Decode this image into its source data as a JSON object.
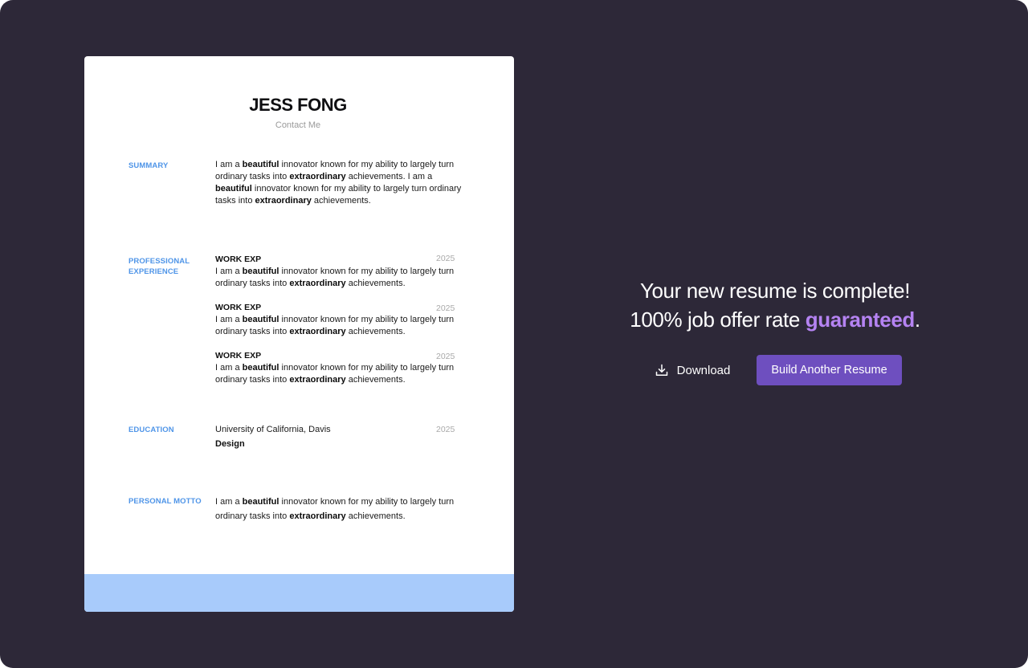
{
  "resume": {
    "name": "JESS FONG",
    "contact": "Contact Me",
    "summary": {
      "label": "SUMMARY",
      "parts": [
        "I am a ",
        "beautiful",
        " innovator known for my ability to largely turn ordinary tasks into ",
        "extraordinary",
        " achievements. I am a ",
        "beautiful",
        " innovator known for my ability to largely turn ordinary tasks into ",
        "extraordinary",
        " achievements."
      ]
    },
    "experience": {
      "label_line1": "PROFESSIONAL",
      "label_line2": "EXPERIENCE",
      "entries": [
        {
          "title": "WORK EXP",
          "year": "2025",
          "parts": [
            "I am a ",
            "beautiful",
            " innovator known for my ability to largely turn ordinary tasks into ",
            "extraordinary",
            " achievements."
          ]
        },
        {
          "title": "WORK EXP",
          "year": "2025",
          "parts": [
            "I am a ",
            "beautiful",
            " innovator known for my ability to largely turn ordinary tasks into ",
            "extraordinary",
            " achievements."
          ]
        },
        {
          "title": "WORK EXP",
          "year": "2025",
          "parts": [
            "I am a ",
            "beautiful",
            " innovator known for my ability to largely turn ordinary tasks into ",
            "extraordinary",
            " achievements."
          ]
        }
      ]
    },
    "education": {
      "label": "EDUCATION",
      "school": "University of California, Davis",
      "year": "2025",
      "major": "Design"
    },
    "motto": {
      "label": "PERSONAL MOTTO",
      "parts": [
        "I am a ",
        "beautiful",
        " innovator known for my ability to largely turn ordinary tasks into ",
        "extraordinary",
        " achievements."
      ]
    }
  },
  "completion": {
    "line1": "Your new resume is complete!",
    "line2_prefix": "100% job offer rate ",
    "line2_accent": "guaranteed",
    "line2_suffix": "."
  },
  "actions": {
    "download_label": "Download",
    "download_icon": "download-icon",
    "build_label": "Build Another Resume"
  },
  "colors": {
    "background": "#2d2838",
    "accent_purple": "#b583f2",
    "button_purple": "#6e4fbf",
    "section_label_blue": "#4f95e8",
    "resume_footer_blue": "#a8cbfb"
  }
}
